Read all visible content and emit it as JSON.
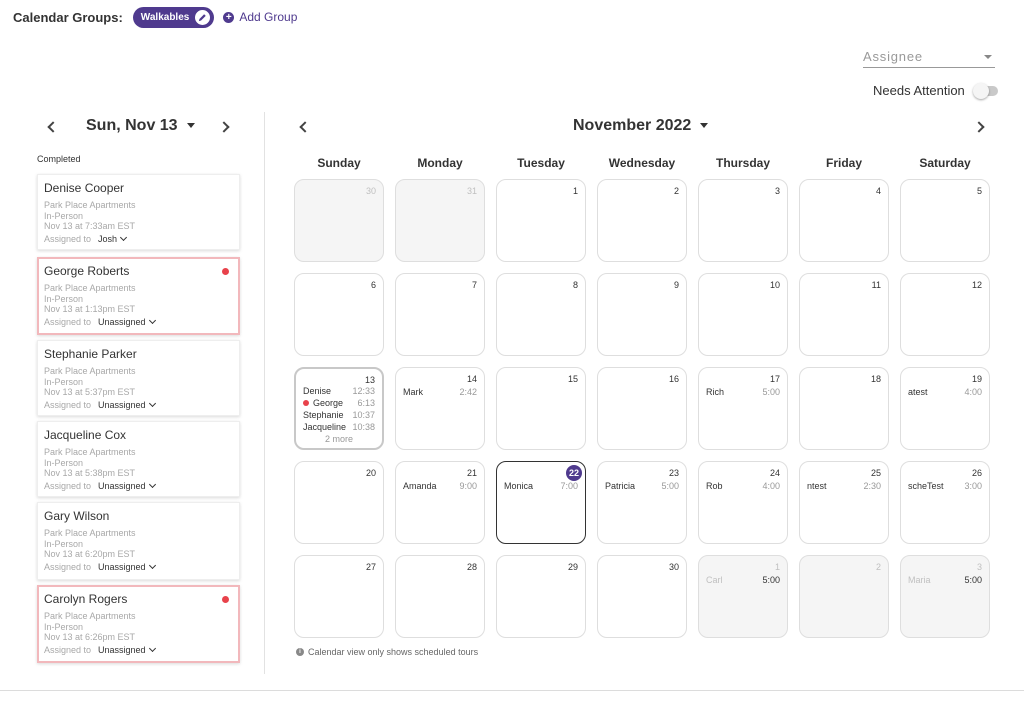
{
  "topbar": {
    "groups_label": "Calendar Groups:",
    "active_group": "Walkables",
    "add_group_label": "Add Group"
  },
  "filters": {
    "assignee_placeholder": "Assignee",
    "needs_attention_label": "Needs Attention",
    "needs_attention_on": false
  },
  "left_panel": {
    "date_title": "Sun, Nov 13",
    "section_label": "Completed",
    "assigned_to_label": "Assigned to",
    "tours": [
      {
        "name": "Denise Cooper",
        "property": "Park Place Apartments",
        "type": "In-Person",
        "time": "Nov 13 at 7:33am EST",
        "assignee": "Josh",
        "attention": false
      },
      {
        "name": "George Roberts",
        "property": "Park Place Apartments",
        "type": "In-Person",
        "time": "Nov 13 at 1:13pm EST",
        "assignee": "Unassigned",
        "attention": true
      },
      {
        "name": "Stephanie Parker",
        "property": "Park Place Apartments",
        "type": "In-Person",
        "time": "Nov 13 at 5:37pm EST",
        "assignee": "Unassigned",
        "attention": false
      },
      {
        "name": "Jacqueline Cox",
        "property": "Park Place Apartments",
        "type": "In-Person",
        "time": "Nov 13 at 5:38pm EST",
        "assignee": "Unassigned",
        "attention": false
      },
      {
        "name": "Gary Wilson",
        "property": "Park Place Apartments",
        "type": "In-Person",
        "time": "Nov 13 at 6:20pm EST",
        "assignee": "Unassigned",
        "attention": false
      },
      {
        "name": "Carolyn Rogers",
        "property": "Park Place Apartments",
        "type": "In-Person",
        "time": "Nov 13 at 6:26pm EST",
        "assignee": "Unassigned",
        "attention": true
      }
    ]
  },
  "calendar": {
    "month_title": "November 2022",
    "weekdays": [
      "Sunday",
      "Monday",
      "Tuesday",
      "Wednesday",
      "Thursday",
      "Friday",
      "Saturday"
    ],
    "footnote": "Calendar view only shows scheduled tours",
    "days": [
      {
        "day": "30",
        "muted": true,
        "events": []
      },
      {
        "day": "31",
        "muted": true,
        "events": []
      },
      {
        "day": "1",
        "events": []
      },
      {
        "day": "2",
        "events": []
      },
      {
        "day": "3",
        "events": []
      },
      {
        "day": "4",
        "events": []
      },
      {
        "day": "5",
        "events": []
      },
      {
        "day": "6",
        "events": []
      },
      {
        "day": "7",
        "events": []
      },
      {
        "day": "8",
        "events": []
      },
      {
        "day": "9",
        "events": []
      },
      {
        "day": "10",
        "events": []
      },
      {
        "day": "11",
        "events": []
      },
      {
        "day": "12",
        "events": []
      },
      {
        "day": "13",
        "selected": true,
        "events": [
          {
            "name": "Denise",
            "time": "12:33"
          },
          {
            "name": "George",
            "time": "6:13",
            "dot": true
          },
          {
            "name": "Stephanie",
            "time": "10:37"
          },
          {
            "name": "Jacqueline",
            "time": "10:38"
          }
        ],
        "more": "2 more"
      },
      {
        "day": "14",
        "events": [
          {
            "name": "Mark",
            "time": "2:42"
          }
        ]
      },
      {
        "day": "15",
        "events": []
      },
      {
        "day": "16",
        "events": []
      },
      {
        "day": "17",
        "events": [
          {
            "name": "Rich",
            "time": "5:00"
          }
        ]
      },
      {
        "day": "18",
        "events": []
      },
      {
        "day": "19",
        "events": [
          {
            "name": "atest",
            "time": "4:00"
          }
        ]
      },
      {
        "day": "20",
        "events": []
      },
      {
        "day": "21",
        "events": [
          {
            "name": "Amanda",
            "time": "9:00"
          }
        ]
      },
      {
        "day": "22",
        "today": true,
        "events": [
          {
            "name": "Monica",
            "time": "7:00"
          }
        ]
      },
      {
        "day": "23",
        "events": [
          {
            "name": "Patricia",
            "time": "5:00"
          }
        ]
      },
      {
        "day": "24",
        "events": [
          {
            "name": "Rob",
            "time": "4:00"
          }
        ]
      },
      {
        "day": "25",
        "events": [
          {
            "name": "ntest",
            "time": "2:30"
          }
        ]
      },
      {
        "day": "26",
        "events": [
          {
            "name": "scheTest",
            "time": "3:00"
          }
        ]
      },
      {
        "day": "27",
        "events": []
      },
      {
        "day": "28",
        "events": []
      },
      {
        "day": "29",
        "events": []
      },
      {
        "day": "30",
        "events": []
      },
      {
        "day": "1",
        "muted": true,
        "events": [
          {
            "name": "Carl",
            "time": "5:00"
          }
        ]
      },
      {
        "day": "2",
        "muted": true,
        "events": []
      },
      {
        "day": "3",
        "muted": true,
        "events": [
          {
            "name": "Maria",
            "time": "5:00"
          }
        ]
      }
    ]
  }
}
